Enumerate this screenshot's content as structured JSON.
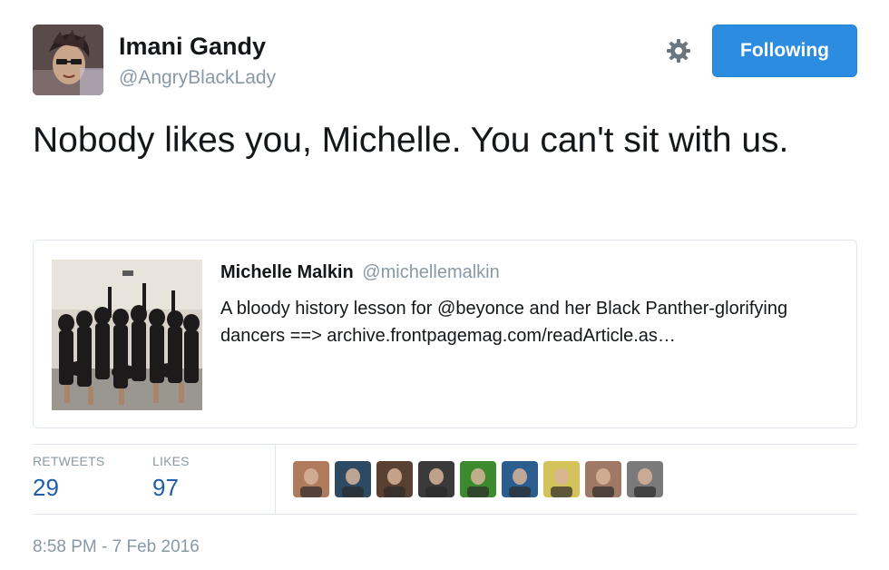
{
  "author": {
    "name": "Imani Gandy",
    "handle": "@AngryBlackLady"
  },
  "actions": {
    "follow_label": "Following",
    "settings_icon": "gear-icon"
  },
  "tweet": {
    "text": "Nobody likes you, Michelle. You can't sit with us."
  },
  "quote": {
    "name": "Michelle Malkin",
    "handle": "@michellemalkin",
    "text": "A bloody history lesson for @beyonce and her Black Panther-glorifying dancers ==> archive.frontpagemag.com/readArticle.as…"
  },
  "stats": {
    "retweets_label": "RETWEETS",
    "retweets": "29",
    "likes_label": "LIKES",
    "likes": "97"
  },
  "likers": [
    {
      "color": "#b07a5c"
    },
    {
      "color": "#2e4a63"
    },
    {
      "color": "#5a4030"
    },
    {
      "color": "#3a3a3a"
    },
    {
      "color": "#3d8a2e"
    },
    {
      "color": "#2c5d8f"
    },
    {
      "color": "#d4c25a"
    },
    {
      "color": "#a07866"
    },
    {
      "color": "#7a7a7a"
    }
  ],
  "timestamp": "8:58 PM - 7 Feb 2016"
}
